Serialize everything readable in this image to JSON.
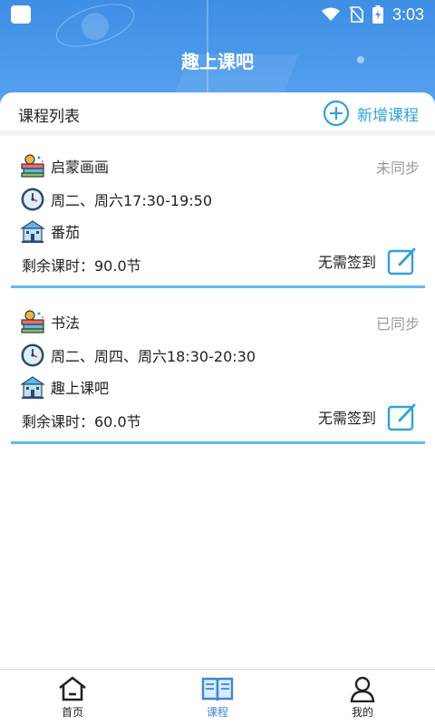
{
  "status_bar": {
    "time": "3:03"
  },
  "header": {
    "title": "趣上课吧"
  },
  "list": {
    "title": "课程列表",
    "add_label": "新增课程"
  },
  "courses": [
    {
      "name": "启蒙画画",
      "sync_status": "未同步",
      "schedule": "周二、周六17:30-19:50",
      "location": "番茄",
      "remaining": "剩余课时：90.0节",
      "signin": "无需签到"
    },
    {
      "name": "书法",
      "sync_status": "已同步",
      "schedule": "周二、周四、周六18:30-20:30",
      "location": "趣上课吧",
      "remaining": "剩余课时：60.0节",
      "signin": "无需签到"
    }
  ],
  "nav": [
    {
      "label": "首页",
      "icon": "home-icon"
    },
    {
      "label": "课程",
      "icon": "book-icon",
      "active": true
    },
    {
      "label": "我的",
      "icon": "profile-icon"
    }
  ],
  "colors": {
    "header": "#4a96e9",
    "accent": "#2fa1db",
    "card_line": "#5bbcec",
    "nav_active": "#3b87d6"
  }
}
